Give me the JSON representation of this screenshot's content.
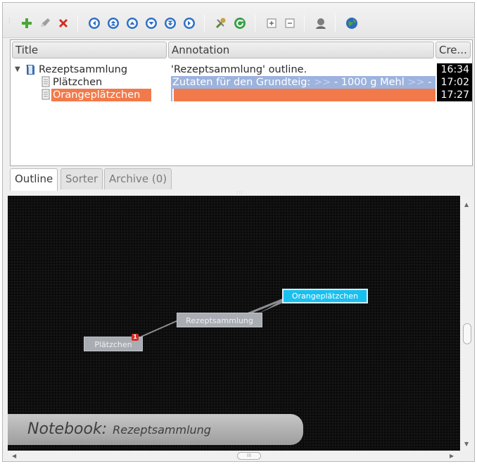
{
  "toolbar": {
    "icons": [
      "add-icon",
      "edit-icon",
      "delete-icon",
      "move-left-icon",
      "move-up-first-icon",
      "move-up-icon",
      "move-down-icon",
      "move-down-last-icon",
      "move-right-icon",
      "tools-icon",
      "refresh-icon",
      "expand-icon",
      "collapse-icon",
      "user-icon",
      "globe-icon"
    ],
    "colors": {
      "add": "#4ca534",
      "delete": "#d42a1e",
      "nav_blue": "#2f6fc6",
      "refresh": "#3aa04a"
    }
  },
  "tree": {
    "columns": {
      "title": "Title",
      "annotation": "Annotation",
      "created": "Cre..."
    },
    "rows": [
      {
        "title": "Rezeptsammlung",
        "annotation": "'Rezeptsammlung' outline.",
        "created": "16:34"
      },
      {
        "title": "Plätzchen",
        "annotation_part1": "Zutaten für den Grundteig:",
        "annotation_arrows1": ">>",
        "annotation_part2": "- 1000 g Mehl",
        "annotation_arrows2": ">>",
        "annotation_part3": "-",
        "created": "17:02"
      },
      {
        "title": "Orangeplätzchen",
        "annotation": "",
        "created": "17:27"
      }
    ],
    "selection_colors": {
      "annotation_highlight": "#9cb3de",
      "title_selected": "#f27a4a"
    }
  },
  "tabs": [
    {
      "label": "Outline",
      "active": true
    },
    {
      "label": "Sorter",
      "active": false
    },
    {
      "label": "Archive (0)",
      "active": false
    }
  ],
  "mindmap": {
    "nodes": {
      "root": "Rezeptsammlung",
      "child1": "Plätzchen",
      "child2": "Orangeplätzchen"
    },
    "badge": "1",
    "active_node_color": "#19c0ef"
  },
  "notebook": {
    "label": "Notebook:",
    "name": "Rezeptsammlung"
  },
  "scroll": {
    "hthumb_label": "III"
  }
}
